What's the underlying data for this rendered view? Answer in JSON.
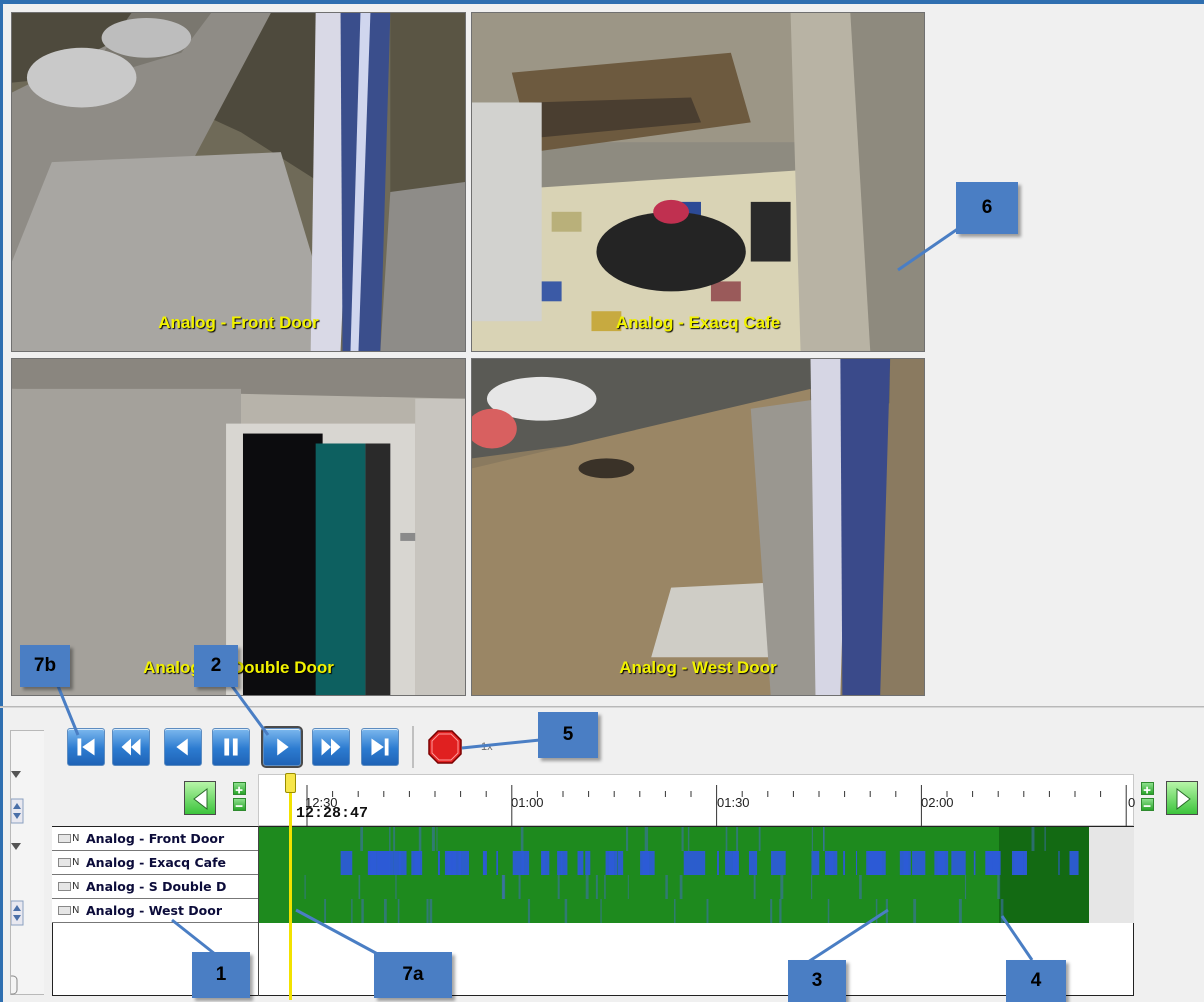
{
  "cameras": [
    {
      "label": "Analog - Front Door"
    },
    {
      "label": "Analog - Exacq Cafe"
    },
    {
      "label": "Analog - S Double Door"
    },
    {
      "label": "Analog - West Door"
    }
  ],
  "playback": {
    "buttons": [
      "skip-to-start",
      "rewind-fast",
      "step-back",
      "pause",
      "play",
      "fast-forward",
      "skip-to-end",
      "stop-record"
    ],
    "active_button": "play",
    "speed": "1x"
  },
  "timeline": {
    "ticks": [
      "12:30",
      "01:00",
      "01:30",
      "02:00",
      "0"
    ],
    "cursor_time": "12:28:47",
    "rows": [
      {
        "label": "Analog - Front Door"
      },
      {
        "label": "Analog - Exacq Cafe"
      },
      {
        "label": "Analog - S Double D"
      },
      {
        "label": "Analog - West Door"
      }
    ]
  },
  "callouts": {
    "c1": "1",
    "c2": "2",
    "c3": "3",
    "c4": "4",
    "c5": "5",
    "c6": "6",
    "c7a": "7a",
    "c7b": "7b"
  },
  "colors": {
    "recording_green": "#1e8a1e",
    "motion_blue": "#2c5bd6",
    "label_yellow": "#f2f200",
    "callout_blue": "#4a7ec4",
    "playhead": "#f2e200"
  }
}
